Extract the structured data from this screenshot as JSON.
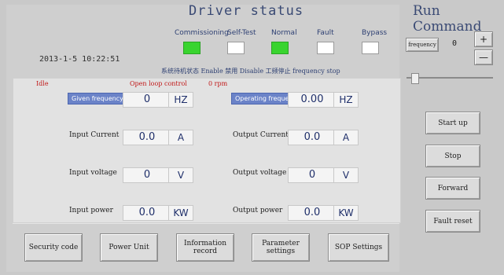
{
  "app": {
    "title": "Driver status",
    "run_title": "Run Command",
    "datetime": "2013-1-5 10:22:51"
  },
  "status_indicators": [
    {
      "label": "Commissioning",
      "state": "green"
    },
    {
      "label": "Self-Test",
      "state": "white"
    },
    {
      "label": "Normal",
      "state": "green"
    },
    {
      "label": "Fault",
      "state": "white"
    },
    {
      "label": "Bypass",
      "state": "white"
    }
  ],
  "mode_strip": "系统待机状态 Enable 禁用 Disable 工频停止 frequency stop",
  "status_line": {
    "state": "Idle",
    "control": "Open loop control",
    "rpm": "0 rpm"
  },
  "main_rows": [
    {
      "left_label": "Given frequency",
      "left_value": "0",
      "left_unit": "HZ",
      "right_label": "Operating frequency",
      "right_value": "0.00",
      "right_unit": "HZ"
    },
    {
      "left_label": "Input Current",
      "left_value": "0.0",
      "left_unit": "A",
      "right_label": "Output Current",
      "right_value": "0.0",
      "right_unit": "A"
    },
    {
      "left_label": "Input voltage",
      "left_value": "0",
      "left_unit": "V",
      "right_label": "Output voltage",
      "right_value": "0",
      "right_unit": "V"
    },
    {
      "left_label": "Input power",
      "left_value": "0.0",
      "left_unit": "KW",
      "right_label": "Output power",
      "right_value": "0.0",
      "right_unit": "KW"
    }
  ],
  "bottom_buttons": [
    "Security code",
    "Power Unit",
    "Information record",
    "Parameter settings",
    "SOP Settings"
  ],
  "run_panel": {
    "frequency_label": "frequency",
    "frequency_value": "0",
    "plus": "+",
    "minus": "—",
    "slider_value": 0
  },
  "run_buttons": [
    "Start up",
    "Stop",
    "Forward",
    "Fault reset"
  ]
}
